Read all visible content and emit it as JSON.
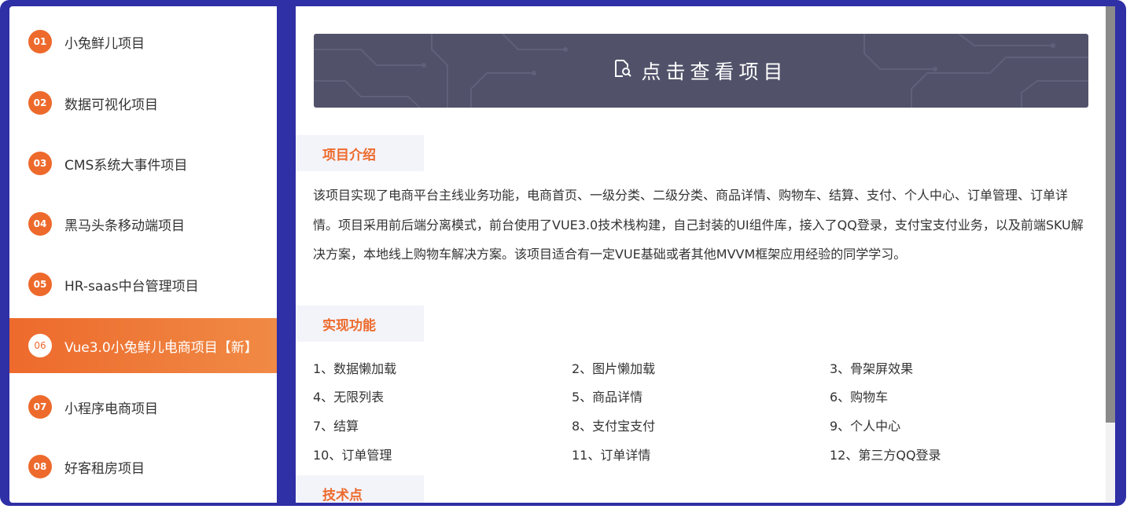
{
  "sidebar": {
    "items": [
      {
        "num": "01",
        "label": "小兔鲜儿项目"
      },
      {
        "num": "02",
        "label": "数据可视化项目"
      },
      {
        "num": "03",
        "label": "CMS系统大事件项目"
      },
      {
        "num": "04",
        "label": "黑马头条移动端项目"
      },
      {
        "num": "05",
        "label": "HR-saas中台管理项目"
      },
      {
        "num": "06",
        "label": "Vue3.0小兔鲜儿电商项目【新】"
      },
      {
        "num": "07",
        "label": "小程序电商项目"
      },
      {
        "num": "08",
        "label": "好客租房项目"
      }
    ],
    "active_index": 5
  },
  "banner": {
    "label": "点击查看项目",
    "icon": "document-search-icon"
  },
  "sections": {
    "intro_title": "项目介绍",
    "intro_text": "该项目实现了电商平台主线业务功能，电商首页、一级分类、二级分类、商品详情、购物车、结算、支付、个人中心、订单管理、订单详情。项目采用前后端分离模式，前台使用了VUE3.0技术栈构建，自己封装的UI组件库，接入了QQ登录，支付宝支付业务，以及前端SKU解决方案，本地线上购物车解决方案。该项目适合有一定VUE基础或者其他MVVM框架应用经验的同学学习。",
    "features_title": "实现功能",
    "features": [
      "1、数据懒加载",
      "2、图片懒加载",
      "3、骨架屏效果",
      "4、无限列表",
      "5、商品详情",
      "6、购物车",
      "7、结算",
      "8、支付宝支付",
      "9、个人中心",
      "10、订单管理",
      "11、订单详情",
      "12、第三方QQ登录"
    ],
    "tech_title": "技术点"
  },
  "colors": {
    "accent": "#ed6a2c",
    "frame": "#2f2fa6",
    "banner": "#51526a",
    "section_bg": "#f3f4fa"
  }
}
